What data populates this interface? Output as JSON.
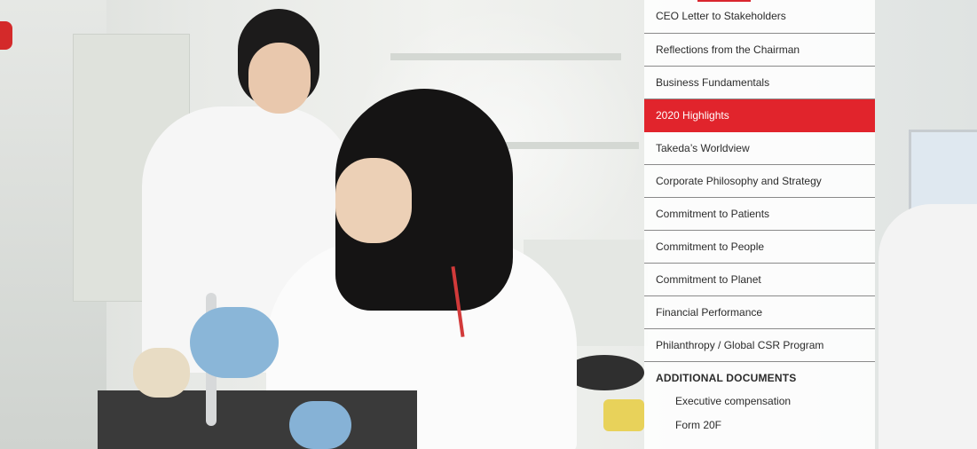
{
  "menu": {
    "items": [
      {
        "label": "CEO Letter to Stakeholders",
        "active": false
      },
      {
        "label": "Reflections from the Chairman",
        "active": false
      },
      {
        "label": "Business Fundamentals",
        "active": false
      },
      {
        "label": "2020 Highlights",
        "active": true
      },
      {
        "label": "Takeda’s Worldview",
        "active": false
      },
      {
        "label": "Corporate Philosophy and Strategy",
        "active": false
      },
      {
        "label": "Commitment to Patients",
        "active": false
      },
      {
        "label": "Commitment to People",
        "active": false
      },
      {
        "label": "Commitment to Planet",
        "active": false
      },
      {
        "label": "Financial Performance",
        "active": false
      },
      {
        "label": "Philanthropy / Global CSR Program",
        "active": false
      }
    ],
    "additional_heading": "ADDITIONAL DOCUMENTS",
    "additional_items": [
      {
        "label": "Executive compensation"
      },
      {
        "label": "Form 20F"
      }
    ]
  },
  "colors": {
    "accent": "#e1242c",
    "menu_text": "#2b2b2b",
    "active_text": "#ffffff"
  },
  "background": {
    "icon": "lab-photo-image"
  }
}
